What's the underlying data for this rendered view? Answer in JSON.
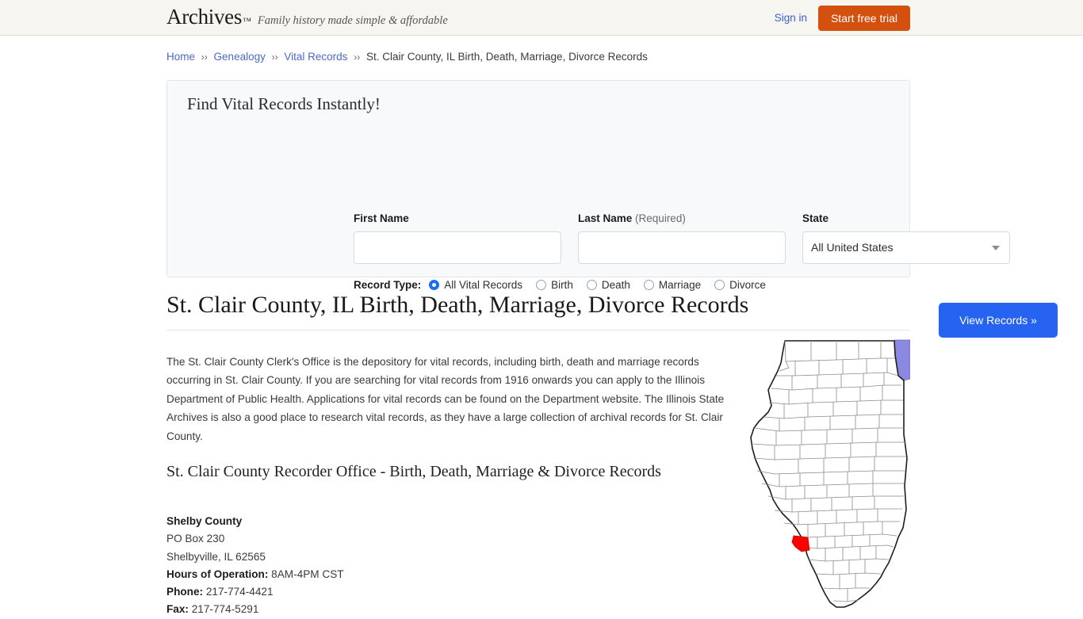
{
  "header": {
    "logo": "Archives",
    "trademark": "™",
    "tagline": "Family history made simple & affordable",
    "signin_label": "Sign in",
    "trial_label": "Start free trial",
    "accent_orange": "#d4500f",
    "link_blue": "#3b5ed6",
    "background": "#f6f5f0"
  },
  "breadcrumb": {
    "items": [
      {
        "label": "Home",
        "link": true
      },
      {
        "label": "Genealogy",
        "link": true
      },
      {
        "label": "Vital Records",
        "link": true
      },
      {
        "label": "St. Clair County, IL Birth, Death, Marriage, Divorce Records",
        "link": false
      }
    ],
    "separator": "››"
  },
  "search_panel": {
    "title": "Find Vital Records Instantly!",
    "first_name": {
      "label": "First Name",
      "value": "",
      "placeholder": ""
    },
    "last_name": {
      "label": "Last Name",
      "required_note": "(Required)",
      "value": "",
      "placeholder": ""
    },
    "state": {
      "label": "State",
      "selected": "All United States"
    },
    "record_type": {
      "label": "Record Type:",
      "options": [
        {
          "label": "All Vital Records",
          "selected": true
        },
        {
          "label": "Birth",
          "selected": false
        },
        {
          "label": "Death",
          "selected": false
        },
        {
          "label": "Marriage",
          "selected": false
        },
        {
          "label": "Divorce",
          "selected": false
        }
      ]
    },
    "submit_label": "View Records »",
    "submit_color": "#2563f0",
    "background": "#f7f9fb"
  },
  "main": {
    "title": "St. Clair County, IL Birth, Death, Marriage, Divorce Records",
    "paragraph": "The St. Clair County Clerk's Office is the depository for vital records, including birth, death and marriage records occurring in St. Clair County. If you are searching for vital records from 1916 onwards you can apply to the Illinois Department of Public Health. Applications for vital records can be found on the Department website. The Illinois State Archives is also a good place to research vital records, as they have a large collection of archival records for St. Clair County.",
    "sub_heading": "St. Clair County Recorder Office - Birth, Death, Marriage & Divorce Records",
    "address": {
      "office_name": "Shelby County",
      "street": "PO Box 230",
      "city_state_zip": "Shelbyville, IL 62565",
      "hours_label": "Hours of Operation:",
      "hours_value": "8AM-4PM CST",
      "phone_label": "Phone:",
      "phone_value": "217-774-4421",
      "fax_label": "Fax:",
      "fax_value": "217-774-5291"
    }
  },
  "map": {
    "state": "Illinois",
    "highlighted_county": "St. Clair County",
    "highlight_color": "#ff0000",
    "lake_color": "#8a88e0",
    "border_color": "#8a8a8a",
    "outline_color": "#222222",
    "fill_color": "#ffffff"
  }
}
